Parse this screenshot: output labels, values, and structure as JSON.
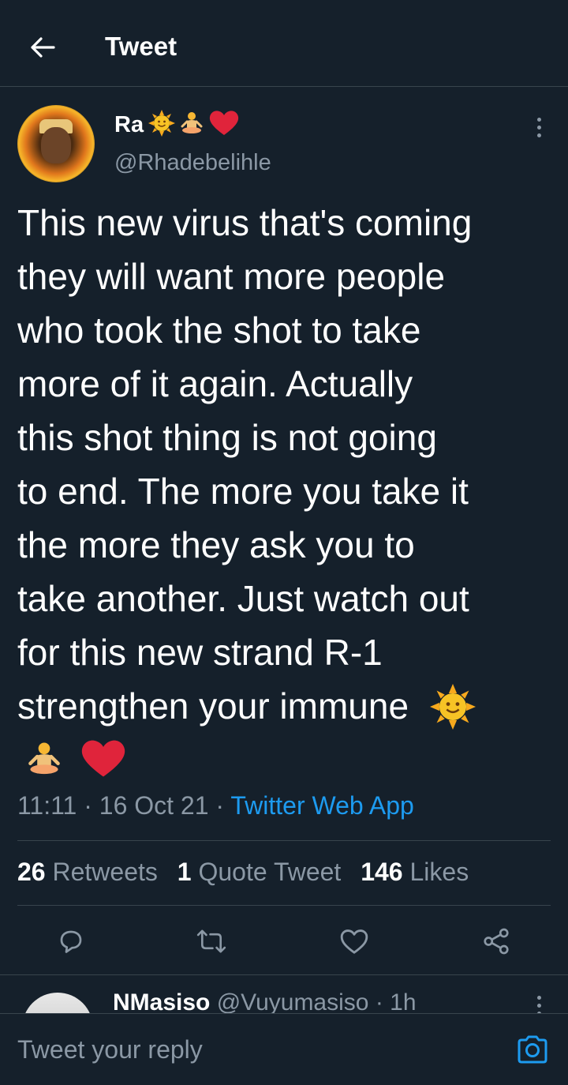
{
  "header": {
    "title": "Tweet"
  },
  "tweet": {
    "author_name": "Ra",
    "author_handle": "@Rhadebelihle",
    "name_emoji_icons": [
      "sun-face-icon",
      "person-in-lotus-position-icon",
      "red-heart-icon"
    ],
    "text_lines": [
      "This new virus that's coming",
      "they will want more people",
      "who took the shot to take",
      "more of it again. Actually",
      "this shot thing is not going",
      "to end. The more you take it",
      "the more they ask you to",
      "take another. Just watch out",
      "for this new strand R-1",
      "strengthen your immune"
    ],
    "text_trailing_emoji": [
      "sun-face-icon",
      "person-in-lotus-position-icon",
      "red-heart-icon"
    ],
    "time": "11:11",
    "date": "16 Oct 21",
    "source": "Twitter Web App",
    "stats": {
      "retweets_count": "26",
      "retweets_label": "Retweets",
      "quotes_count": "1",
      "quotes_label": "Quote Tweet",
      "likes_count": "146",
      "likes_label": "Likes"
    }
  },
  "actions": [
    "reply-icon",
    "retweet-icon",
    "like-icon",
    "share-icon"
  ],
  "reply_preview": {
    "name": "NMasiso",
    "handle": "@Vuyumasiso",
    "time": "1h"
  },
  "composer": {
    "placeholder": "Tweet your reply"
  },
  "colors": {
    "background": "#15202b",
    "muted": "#8b98a5",
    "link": "#1d9bf0",
    "divider": "#38444d",
    "heart": "#e0243b",
    "sun": "#f7c325"
  }
}
